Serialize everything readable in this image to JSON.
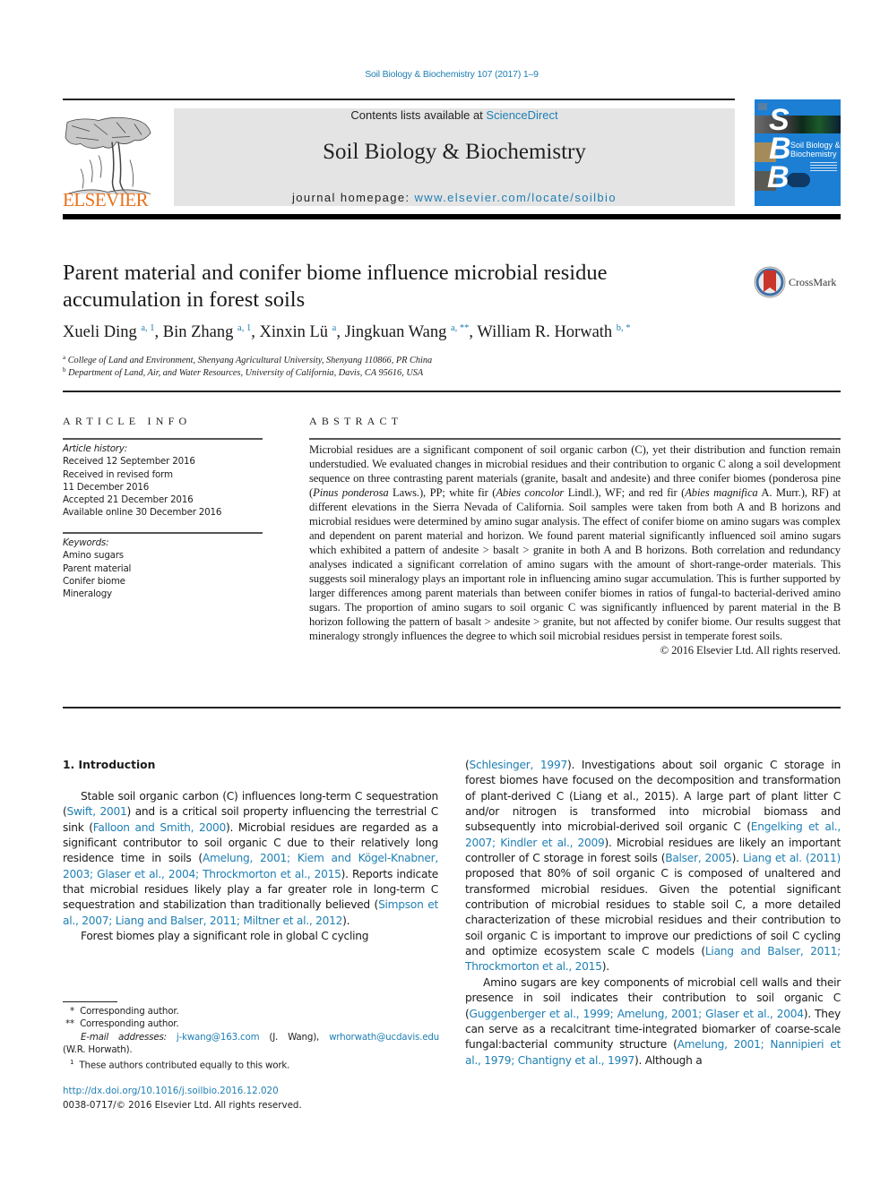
{
  "header": {
    "citation": "Soil Biology & Biochemistry 107 (2017) 1–9",
    "contents_prefix": "Contents lists available at ",
    "contents_link": "ScienceDirect",
    "journal_name": "Soil Biology & Biochemistry",
    "homepage_prefix": "journal homepage: ",
    "homepage_link": "www.elsevier.com/locate/soilbio",
    "publisher_logo_text": "ELSEVIER",
    "cover_letters": [
      "S",
      "B",
      "B"
    ],
    "cover_title_line1": "Soil Biology &",
    "cover_title_line2": "Biochemistry",
    "crossmark_label": "CrossMark"
  },
  "article": {
    "title": "Parent material and conifer biome influence microbial residue accumulation in forest soils",
    "authors": [
      {
        "name": "Xueli Ding",
        "sup": "a, 1",
        "sep": ", "
      },
      {
        "name": "Bin Zhang",
        "sup": "a, 1",
        "sep": ", "
      },
      {
        "name": "Xinxin Lü",
        "sup": "a",
        "sep": ", "
      },
      {
        "name": "Jingkuan Wang",
        "sup": "a, **",
        "sep": ", "
      },
      {
        "name": "William R. Horwath",
        "sup": "b, *",
        "sep": ""
      }
    ],
    "affiliations": [
      {
        "mark": "a",
        "text": "College of Land and Environment, Shenyang Agricultural University, Shenyang 110866, PR China"
      },
      {
        "mark": "b",
        "text": "Department of Land, Air, and Water Resources, University of California, Davis, CA 95616, USA"
      }
    ]
  },
  "article_info": {
    "heading": "ARTICLE INFO",
    "history_label": "Article history:",
    "history": [
      "Received 12 September 2016",
      "Received in revised form",
      "11 December 2016",
      "Accepted 21 December 2016",
      "Available online 30 December 2016"
    ],
    "keywords_label": "Keywords:",
    "keywords": [
      "Amino sugars",
      "Parent material",
      "Conifer biome",
      "Mineralogy"
    ]
  },
  "abstract": {
    "heading": "ABSTRACT",
    "segments": [
      {
        "t": "Microbial residues are a significant component of soil organic carbon (C), yet their distribution and function remain understudied. We evaluated changes in microbial residues and their contribution to organic C along a soil development sequence on three contrasting parent materials (granite, basalt and andesite) and three conifer biomes (ponderosa pine (",
        "i": false
      },
      {
        "t": "Pinus ponderosa",
        "i": true
      },
      {
        "t": " Laws.), PP; white fir (",
        "i": false
      },
      {
        "t": "Abies concolor",
        "i": true
      },
      {
        "t": " Lindl.), WF; and red fir (",
        "i": false
      },
      {
        "t": "Abies magnifica",
        "i": true
      },
      {
        "t": " A. Murr.), RF) at different elevations in the Sierra Nevada of California. Soil samples were taken from both A and B horizons and microbial residues were determined by amino sugar analysis. The effect of conifer biome on amino sugars was complex and dependent on parent material and horizon. We found parent material significantly influenced soil amino sugars which exhibited a pattern of andesite > basalt > granite in both A and B horizons. Both correlation and redundancy analyses indicated a significant correlation of amino sugars with the amount of short-range-order materials. This suggests soil mineralogy plays an important role in influencing amino sugar accumulation. This is further supported by larger differences among parent materials than between conifer biomes in ratios of fungal-to bacterial-derived amino sugars. The proportion of amino sugars to soil organic C was significantly influenced by parent material in the B horizon following the pattern of basalt > andesite > granite, but not affected by conifer biome. Our results suggest that mineralogy strongly influences the degree to which soil microbial residues persist in temperate forest soils.",
        "i": false
      }
    ],
    "copyright": "© 2016 Elsevier Ltd. All rights reserved."
  },
  "body": {
    "section_title": "1.  Introduction",
    "left_paragraphs": [
      [
        {
          "t": "Stable soil organic carbon (C) influences long-term C sequestration (",
          "l": false
        },
        {
          "t": "Swift, 2001",
          "l": true
        },
        {
          "t": ") and is a critical soil property influencing the terrestrial C sink (",
          "l": false
        },
        {
          "t": "Falloon and Smith, 2000",
          "l": true
        },
        {
          "t": "). Microbial residues are regarded as a significant contributor to soil organic C due to their relatively long residence time in soils (",
          "l": false
        },
        {
          "t": "Amelung, 2001; Kiem and Kögel-Knabner, 2003; Glaser et al., 2004; Throckmorton et al., 2015",
          "l": true
        },
        {
          "t": "). Reports indicate that microbial residues likely play a far greater role in long-term C sequestration and stabilization than traditionally believed (",
          "l": false
        },
        {
          "t": "Simpson et al., 2007; Liang and Balser, 2011; Miltner et al., 2012",
          "l": true
        },
        {
          "t": ").",
          "l": false
        }
      ],
      [
        {
          "t": "Forest biomes play a significant role in global C cycling",
          "l": false
        }
      ]
    ],
    "right_paragraphs": [
      [
        {
          "t": "(",
          "l": false
        },
        {
          "t": "Schlesinger, 1997",
          "l": true
        },
        {
          "t": "). Investigations about soil organic C storage in forest biomes have focused on the decomposition and transformation of plant-derived C (Liang et al., 2015). A large part of plant litter C and/or nitrogen is transformed into microbial biomass and subsequently into microbial-derived soil organic C (",
          "l": false
        },
        {
          "t": "Engelking et al., 2007; Kindler et al., 2009",
          "l": true
        },
        {
          "t": "). Microbial residues are likely an important controller of C storage in forest soils (",
          "l": false
        },
        {
          "t": "Balser, 2005",
          "l": true
        },
        {
          "t": "). ",
          "l": false
        },
        {
          "t": "Liang et al. (2011)",
          "l": true
        },
        {
          "t": " proposed that 80% of soil organic C is composed of unaltered and transformed microbial residues. Given the potential significant contribution of microbial residues to stable soil C, a more detailed characterization of these microbial residues and their contribution to soil organic C is important to improve our predictions of soil C cycling and optimize ecosystem scale C models (",
          "l": false
        },
        {
          "t": "Liang and Balser, 2011; Throckmorton et al., 2015",
          "l": true
        },
        {
          "t": ").",
          "l": false
        }
      ],
      [
        {
          "t": "Amino sugars are key components of microbial cell walls and their presence in soil indicates their contribution to soil organic C (",
          "l": false
        },
        {
          "t": "Guggenberger et al., 1999; Amelung, 2001; Glaser et al., 2004",
          "l": true
        },
        {
          "t": "). They can serve as a recalcitrant time-integrated biomarker of coarse-scale fungal:bacterial community structure (",
          "l": false
        },
        {
          "t": "Amelung, 2001; Nannipieri et al., 1979; Chantigny et al., 1997",
          "l": true
        },
        {
          "t": "). Although a",
          "l": false
        }
      ]
    ]
  },
  "footnotes": {
    "corr1_mark": "*",
    "corr1": "Corresponding author.",
    "corr2_mark": "**",
    "corr2": "Corresponding author.",
    "email_label": "E-mail addresses:",
    "email1": "j-kwang@163.com",
    "email1_name": "(J. Wang),",
    "email2": "wrhorwath@ucdavis.edu",
    "email2_name": "(W.R. Horwath).",
    "equal_mark": "1",
    "equal": "These authors contributed equally to this work.",
    "doi": "http://dx.doi.org/10.1016/j.soilbio.2016.12.020",
    "issn": "0038-0717/© 2016 Elsevier Ltd. All rights reserved."
  }
}
